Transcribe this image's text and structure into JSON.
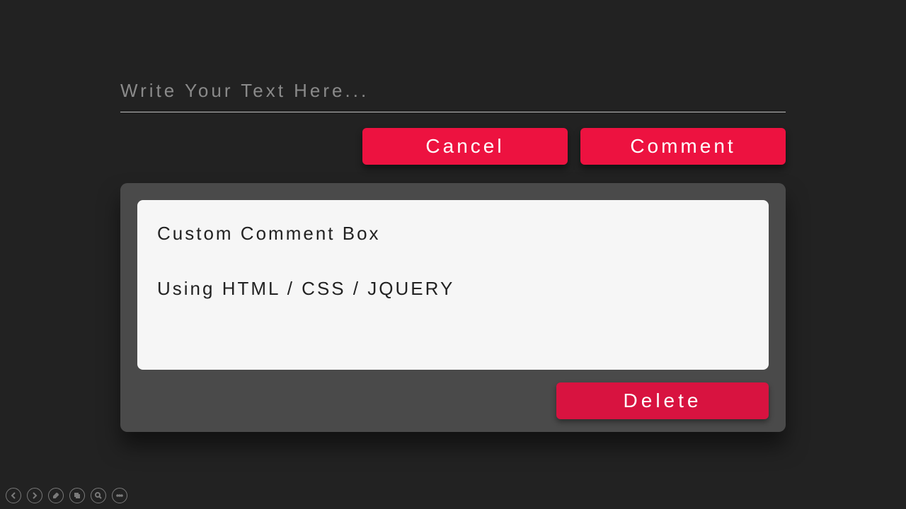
{
  "input": {
    "placeholder": "Write Your Text Here...",
    "value": ""
  },
  "buttons": {
    "cancel": "Cancel",
    "comment": "Comment",
    "delete": "Delete"
  },
  "comment": {
    "text": "Custom Comment Box\n\nUsing HTML / CSS / JQUERY"
  },
  "toolbar": {
    "prev": "prev",
    "next": "next",
    "edit": "edit",
    "copy": "copy",
    "zoom": "zoom",
    "more": "more"
  }
}
